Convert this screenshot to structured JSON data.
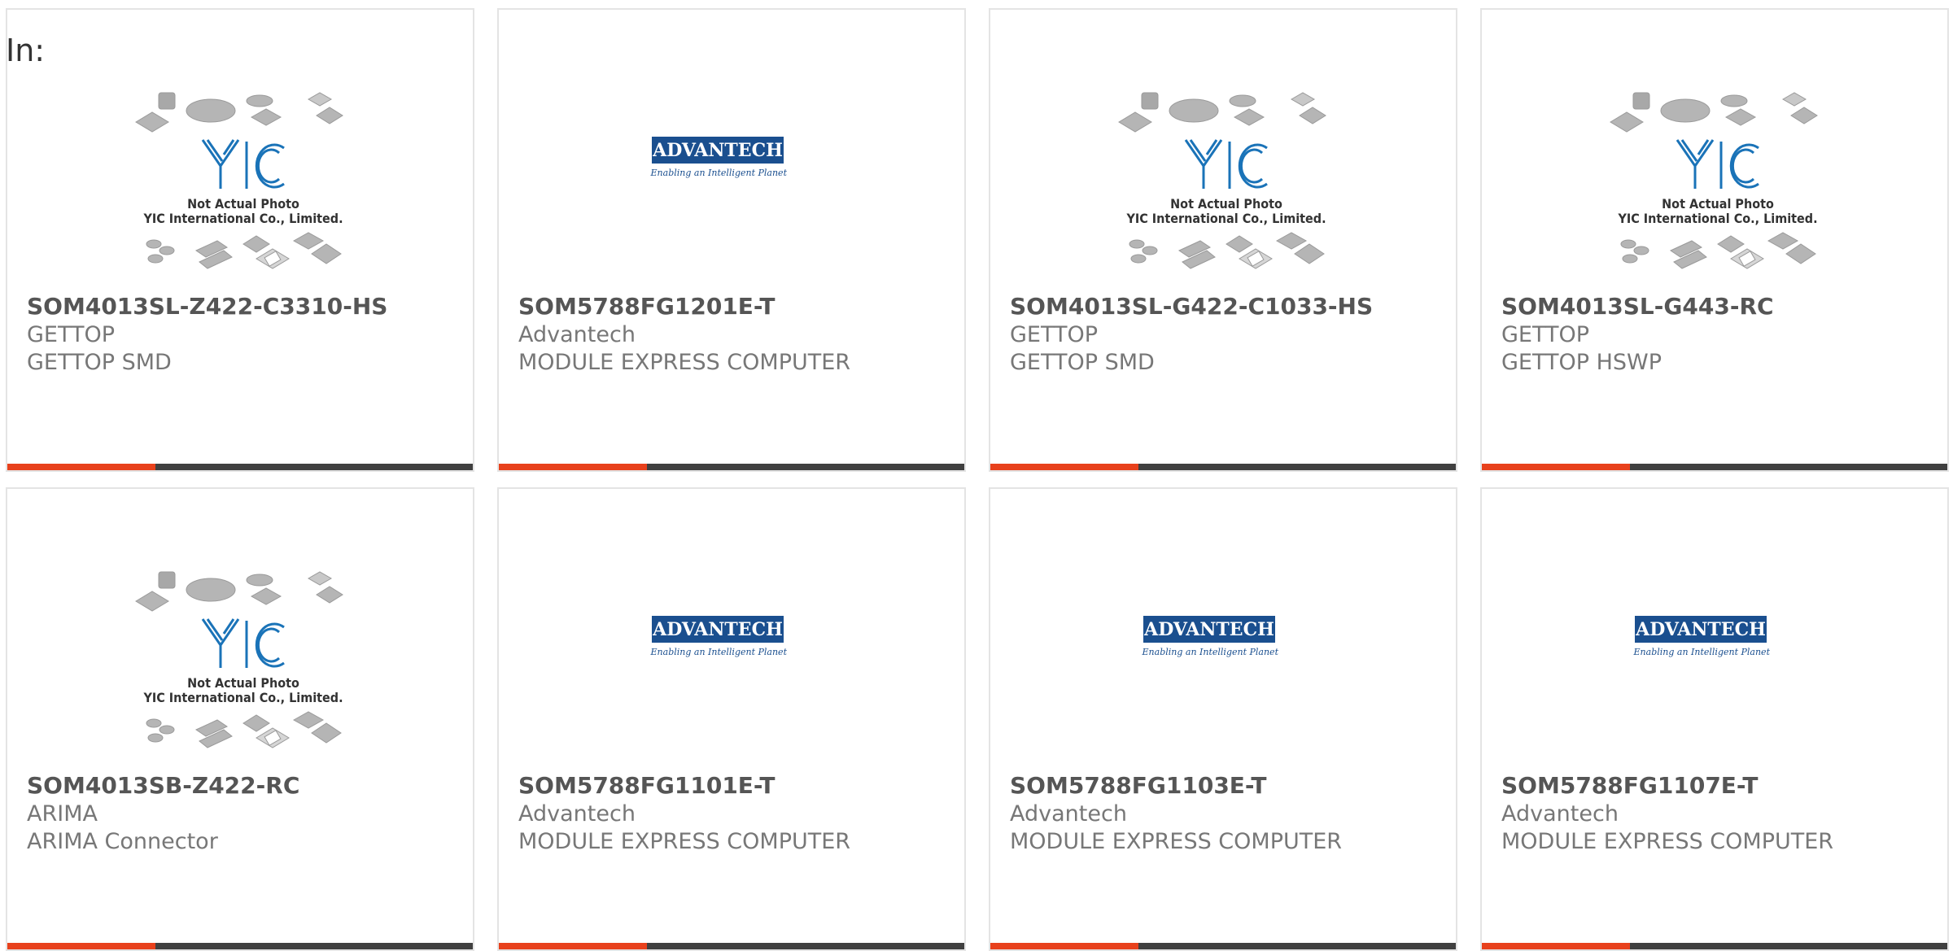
{
  "filter_label": "In:",
  "colors": {
    "bar_accent": "#e8411c",
    "bar_base": "#404040",
    "yic_logo": "#1a73b8",
    "advantech_blue": "#1a4f8f"
  },
  "placeholder_images": {
    "yic": {
      "icon": "yic-placeholder-icon",
      "caption_line1": "Not Actual Photo",
      "caption_line2": "YIC International Co., Limited."
    },
    "advantech": {
      "icon": "advantech-logo-icon",
      "logo_text": "ADVANTECH",
      "tagline": "Enabling an Intelligent Planet"
    }
  },
  "products": [
    {
      "part": "SOM4013SL-Z422-C3310-HS",
      "brand": "GETTOP",
      "desc": "GETTOP SMD",
      "image": "yic"
    },
    {
      "part": "SOM5788FG1201E-T",
      "brand": "Advantech",
      "desc": "MODULE EXPRESS COMPUTER",
      "image": "advantech"
    },
    {
      "part": "SOM4013SL-G422-C1033-HS",
      "brand": "GETTOP",
      "desc": "GETTOP SMD",
      "image": "yic"
    },
    {
      "part": "SOM4013SL-G443-RC",
      "brand": "GETTOP",
      "desc": "GETTOP HSWP",
      "image": "yic"
    },
    {
      "part": "SOM4013SB-Z422-RC",
      "brand": "ARIMA",
      "desc": "ARIMA Connector",
      "image": "yic"
    },
    {
      "part": "SOM5788FG1101E-T",
      "brand": "Advantech",
      "desc": "MODULE EXPRESS COMPUTER",
      "image": "advantech"
    },
    {
      "part": "SOM5788FG1103E-T",
      "brand": "Advantech",
      "desc": "MODULE EXPRESS COMPUTER",
      "image": "advantech"
    },
    {
      "part": "SOM5788FG1107E-T",
      "brand": "Advantech",
      "desc": "MODULE EXPRESS COMPUTER",
      "image": "advantech"
    }
  ]
}
